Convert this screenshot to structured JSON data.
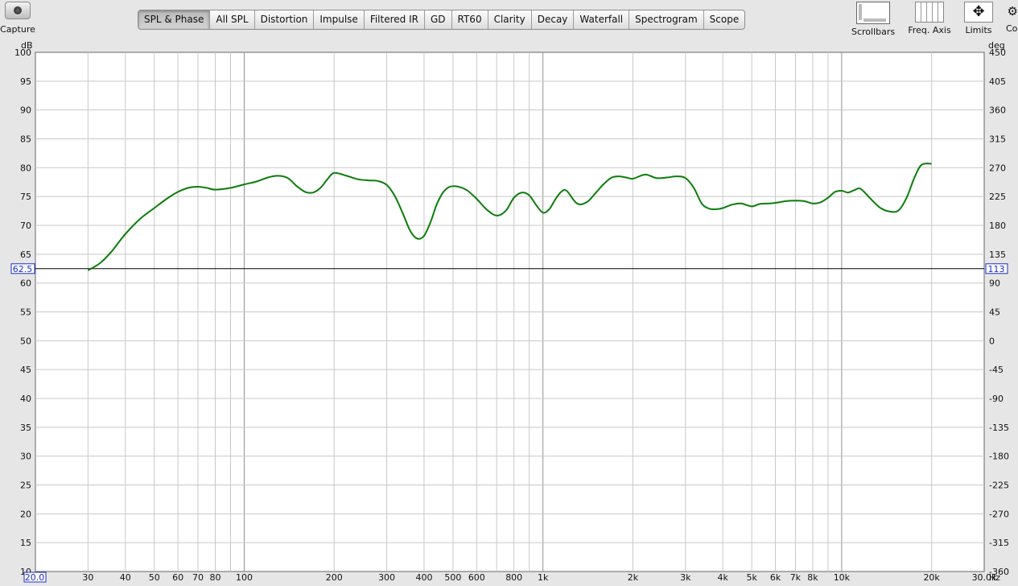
{
  "toolbar": {
    "capture_label": "Capture",
    "tabs": [
      "SPL & Phase",
      "All SPL",
      "Distortion",
      "Impulse",
      "Filtered IR",
      "GD",
      "RT60",
      "Clarity",
      "Decay",
      "Waterfall",
      "Spectrogram",
      "Scope"
    ],
    "active_tab": "SPL & Phase",
    "scrollbars_label": "Scrollbars",
    "freq_axis_label": "Freq. Axis",
    "limits_label": "Limits",
    "cut_label": "Co"
  },
  "colors": {
    "trace": "#0b7d0b",
    "plot_bg": "#ffffff",
    "grid": "#c8c8c8",
    "grid_decade": "#909090",
    "readout": "#1a2ecc"
  },
  "chart_data": {
    "type": "line",
    "x_scale": "log",
    "xlim": [
      20,
      30000
    ],
    "ylim_left": [
      10,
      100
    ],
    "ylim_right": [
      -360,
      450
    ],
    "ylabel_left": "dB",
    "ylabel_right": "deg",
    "x_unit": "Hz",
    "left_ticks": [
      10,
      15,
      20,
      25,
      30,
      35,
      40,
      45,
      50,
      55,
      60,
      65,
      70,
      75,
      80,
      85,
      90,
      95,
      100
    ],
    "right_ticks": [
      -360,
      -315,
      -270,
      -225,
      -180,
      -135,
      -90,
      -45,
      0,
      45,
      90,
      135,
      180,
      225,
      270,
      315,
      360,
      405,
      450
    ],
    "x_ticks": [
      {
        "v": 30,
        "label": "30"
      },
      {
        "v": 40,
        "label": "40"
      },
      {
        "v": 50,
        "label": "50"
      },
      {
        "v": 60,
        "label": "60"
      },
      {
        "v": 70,
        "label": "70"
      },
      {
        "v": 80,
        "label": "80"
      },
      {
        "v": 100,
        "label": "100"
      },
      {
        "v": 200,
        "label": "200"
      },
      {
        "v": 300,
        "label": "300"
      },
      {
        "v": 400,
        "label": "400"
      },
      {
        "v": 500,
        "label": "500"
      },
      {
        "v": 600,
        "label": "600"
      },
      {
        "v": 800,
        "label": "800"
      },
      {
        "v": 1000,
        "label": "1k"
      },
      {
        "v": 2000,
        "label": "2k"
      },
      {
        "v": 3000,
        "label": "3k"
      },
      {
        "v": 4000,
        "label": "4k"
      },
      {
        "v": 5000,
        "label": "5k"
      },
      {
        "v": 6000,
        "label": "6k"
      },
      {
        "v": 7000,
        "label": "7k"
      },
      {
        "v": 8000,
        "label": "8k"
      },
      {
        "v": 10000,
        "label": "10k"
      },
      {
        "v": 20000,
        "label": "20k"
      },
      {
        "v": 30000,
        "label": "30.0k"
      }
    ],
    "x_start_readout": "20.0",
    "cursor_level_db": 62.5,
    "cursor_left_readout": "62.5",
    "cursor_right_readout": "113",
    "series": [
      {
        "x": [
          30,
          33,
          36,
          40,
          45,
          50,
          55,
          60,
          65,
          70,
          75,
          80,
          90,
          100,
          110,
          120,
          130,
          140,
          150,
          160,
          170,
          180,
          190,
          200,
          220,
          240,
          260,
          280,
          300,
          320,
          340,
          360,
          380,
          400,
          420,
          440,
          460,
          480,
          500,
          530,
          560,
          600,
          650,
          700,
          750,
          800,
          850,
          900,
          950,
          1000,
          1050,
          1100,
          1150,
          1200,
          1300,
          1400,
          1500,
          1600,
          1700,
          1800,
          1900,
          2000,
          2200,
          2400,
          2600,
          2800,
          3000,
          3200,
          3400,
          3600,
          3800,
          4000,
          4300,
          4600,
          5000,
          5300,
          5700,
          6000,
          6500,
          7000,
          7500,
          8000,
          8500,
          9000,
          9500,
          10000,
          10500,
          11000,
          11500,
          12000,
          12500,
          13500,
          14500,
          15500,
          16500,
          17500,
          18500,
          20000
        ],
        "y": [
          62.2,
          63.5,
          65.5,
          68.5,
          71.2,
          73.0,
          74.6,
          75.8,
          76.5,
          76.7,
          76.5,
          76.2,
          76.5,
          77.1,
          77.6,
          78.3,
          78.6,
          78.2,
          76.8,
          75.8,
          75.7,
          76.5,
          78.0,
          79.1,
          78.6,
          78.0,
          77.8,
          77.7,
          77.0,
          75.0,
          72.0,
          69.0,
          67.7,
          68.2,
          70.5,
          73.5,
          75.5,
          76.5,
          76.8,
          76.6,
          76.0,
          74.6,
          72.7,
          71.7,
          72.5,
          74.8,
          75.7,
          75.2,
          73.5,
          72.2,
          72.8,
          74.5,
          75.8,
          76.0,
          73.8,
          74.0,
          75.6,
          77.2,
          78.3,
          78.5,
          78.3,
          78.1,
          78.8,
          78.2,
          78.3,
          78.5,
          78.2,
          76.5,
          73.8,
          72.9,
          72.8,
          73.0,
          73.6,
          73.8,
          73.3,
          73.7,
          73.8,
          73.9,
          74.2,
          74.3,
          74.2,
          73.8,
          74.0,
          74.8,
          75.8,
          76.0,
          75.7,
          76.1,
          76.4,
          75.6,
          74.6,
          73.0,
          72.4,
          72.6,
          74.8,
          78.2,
          80.5,
          80.7
        ]
      }
    ]
  }
}
